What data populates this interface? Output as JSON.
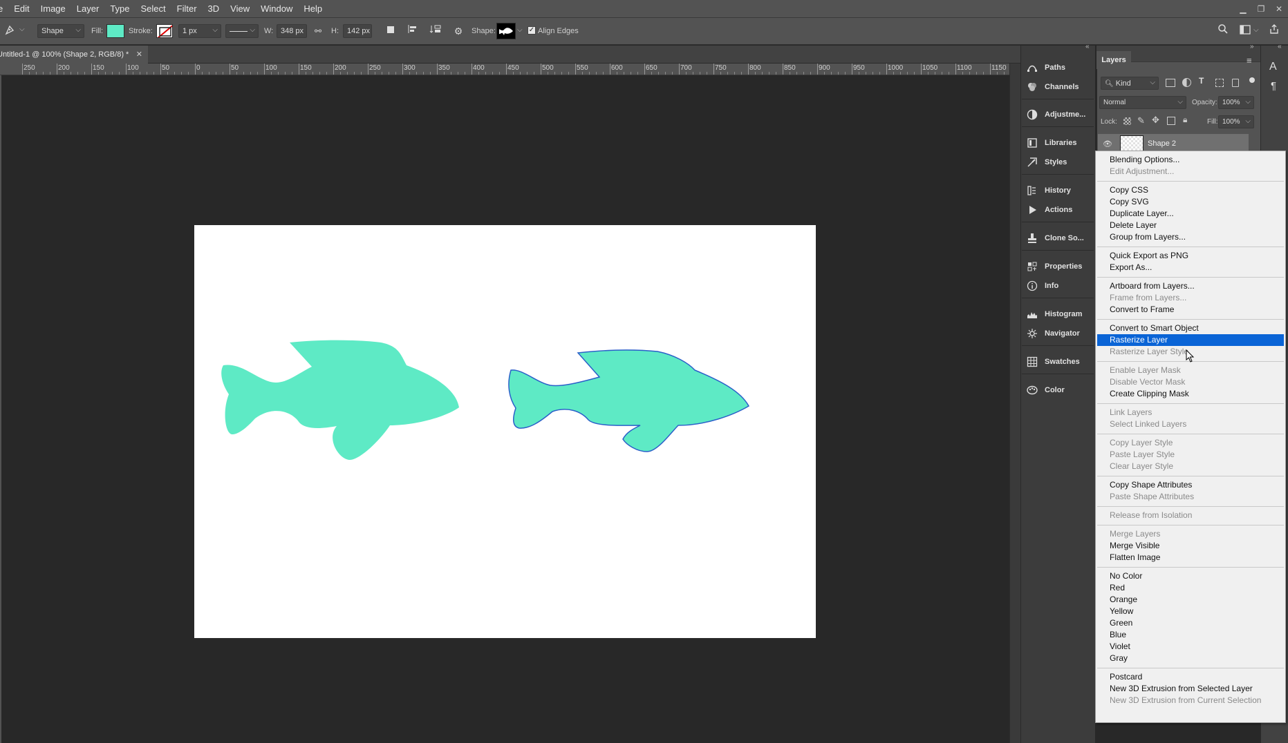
{
  "menubar": {
    "items": [
      "e",
      "Edit",
      "Image",
      "Layer",
      "Type",
      "Select",
      "Filter",
      "3D",
      "View",
      "Window",
      "Help"
    ]
  },
  "options": {
    "tool_mode": "Shape",
    "fill_label": "Fill:",
    "fill_color": "#5eeac5",
    "stroke_label": "Stroke:",
    "stroke_width": "1 px",
    "width_label": "W:",
    "width_value": "348 px",
    "height_label": "H:",
    "height_value": "142 px",
    "shape_label": "Shape:",
    "align_edges_label": "Align Edges",
    "align_edges_checked": true
  },
  "document": {
    "tab_title": "Untitled-1 @ 100% (Shape 2, RGB/8) *",
    "ruler_labels": [
      "250",
      "200",
      "150",
      "100",
      "50",
      "0",
      "50",
      "100",
      "150",
      "200",
      "250",
      "300",
      "350",
      "400",
      "450",
      "500",
      "550",
      "600",
      "650",
      "700",
      "750",
      "800",
      "850",
      "900",
      "950",
      "1000",
      "1050",
      "1100",
      "1150"
    ],
    "shape_fill": "#5eeac5",
    "shape_stroke": "#2a5fc9"
  },
  "dock": {
    "items": [
      "Paths",
      "Channels",
      "Adjustme...",
      "Libraries",
      "Styles",
      "History",
      "Actions",
      "Clone So...",
      "Properties",
      "Info",
      "Histogram",
      "Navigator",
      "Swatches",
      "Color"
    ]
  },
  "layers": {
    "tab": "Layers",
    "kind": "Kind",
    "blend_mode": "Normal",
    "opacity_label": "Opacity:",
    "opacity_value": "100%",
    "lock_label": "Lock:",
    "fill_label": "Fill:",
    "fill_value": "100%",
    "layer_name": "Shape 2"
  },
  "context_menu": {
    "highlight_color": "#0a64d6",
    "items": [
      {
        "label": "Blending Options...",
        "enabled": true
      },
      {
        "label": "Edit Adjustment...",
        "enabled": false
      },
      {
        "label": "Copy CSS",
        "enabled": true
      },
      {
        "label": "Copy SVG",
        "enabled": true
      },
      {
        "label": "Duplicate Layer...",
        "enabled": true
      },
      {
        "label": "Delete Layer",
        "enabled": true
      },
      {
        "label": "Group from Layers...",
        "enabled": true
      },
      {
        "label": "Quick Export as PNG",
        "enabled": true
      },
      {
        "label": "Export As...",
        "enabled": true
      },
      {
        "label": "Artboard from Layers...",
        "enabled": true
      },
      {
        "label": "Frame from Layers...",
        "enabled": false
      },
      {
        "label": "Convert to Frame",
        "enabled": true
      },
      {
        "label": "Convert to Smart Object",
        "enabled": true
      },
      {
        "label": "Rasterize Layer",
        "enabled": true,
        "highlighted": true
      },
      {
        "label": "Rasterize Layer Style",
        "enabled": false
      },
      {
        "label": "Enable Layer Mask",
        "enabled": false
      },
      {
        "label": "Disable Vector Mask",
        "enabled": false
      },
      {
        "label": "Create Clipping Mask",
        "enabled": true
      },
      {
        "label": "Link Layers",
        "enabled": false
      },
      {
        "label": "Select Linked Layers",
        "enabled": false
      },
      {
        "label": "Copy Layer Style",
        "enabled": false
      },
      {
        "label": "Paste Layer Style",
        "enabled": false
      },
      {
        "label": "Clear Layer Style",
        "enabled": false
      },
      {
        "label": "Copy Shape Attributes",
        "enabled": true
      },
      {
        "label": "Paste Shape Attributes",
        "enabled": false
      },
      {
        "label": "Release from Isolation",
        "enabled": false
      },
      {
        "label": "Merge Layers",
        "enabled": false
      },
      {
        "label": "Merge Visible",
        "enabled": true
      },
      {
        "label": "Flatten Image",
        "enabled": true
      },
      {
        "label": "No Color",
        "enabled": true
      },
      {
        "label": "Red",
        "enabled": true
      },
      {
        "label": "Orange",
        "enabled": true
      },
      {
        "label": "Yellow",
        "enabled": true
      },
      {
        "label": "Green",
        "enabled": true
      },
      {
        "label": "Blue",
        "enabled": true
      },
      {
        "label": "Violet",
        "enabled": true
      },
      {
        "label": "Gray",
        "enabled": true
      },
      {
        "label": "Postcard",
        "enabled": true
      },
      {
        "label": "New 3D Extrusion from Selected Layer",
        "enabled": true
      },
      {
        "label": "New 3D Extrusion from Current Selection",
        "enabled": false
      }
    ]
  }
}
